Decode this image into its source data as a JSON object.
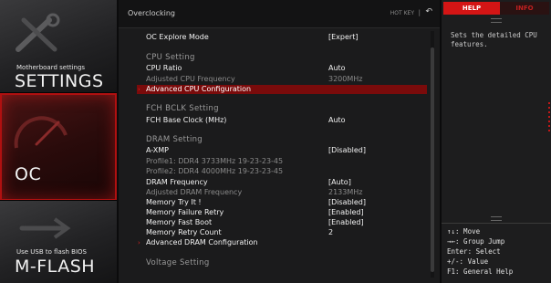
{
  "sidebar": {
    "settings": {
      "small": "Motherboard settings",
      "big": "SETTINGS"
    },
    "oc": {
      "big": "OC"
    },
    "mflash": {
      "small": "Use USB to flash BIOS",
      "big": "M-FLASH"
    }
  },
  "header": {
    "title": "Overclocking",
    "hotkey": "HOT KEY",
    "separator": "|",
    "back_icon": "back-arrow-icon"
  },
  "rows": [
    {
      "label": "OC Explore Mode",
      "value": "[Expert]",
      "style": "white"
    },
    {
      "label": "CPU  Setting",
      "value": "",
      "style": "header"
    },
    {
      "label": "CPU Ratio",
      "value": "Auto",
      "style": "white"
    },
    {
      "label": "Adjusted CPU Frequency",
      "value": "3200MHz",
      "style": "gray"
    },
    {
      "label": "Advanced CPU Configuration",
      "value": "",
      "style": "selected"
    },
    {
      "label": "FCH  BCLK  Setting",
      "value": "",
      "style": "header"
    },
    {
      "label": "FCH Base Clock (MHz)",
      "value": "Auto",
      "style": "white"
    },
    {
      "label": "DRAM  Setting",
      "value": "",
      "style": "header"
    },
    {
      "label": "A-XMP",
      "value": "[Disabled]",
      "style": "white"
    },
    {
      "label": "Profile1: DDR4 3733MHz 19-23-23-45",
      "value": "",
      "style": "gray"
    },
    {
      "label": "Profile2: DDR4 4000MHz 19-23-23-45",
      "value": "",
      "style": "gray"
    },
    {
      "label": "DRAM Frequency",
      "value": "[Auto]",
      "style": "white"
    },
    {
      "label": "Adjusted DRAM Frequency",
      "value": "2133MHz",
      "style": "gray"
    },
    {
      "label": "Memory Try It !",
      "value": "[Disabled]",
      "style": "white"
    },
    {
      "label": "Memory Failure Retry",
      "value": "[Enabled]",
      "style": "white"
    },
    {
      "label": "Memory Fast Boot",
      "value": "[Enabled]",
      "style": "white"
    },
    {
      "label": "Memory Retry Count",
      "value": "2",
      "style": "white"
    },
    {
      "label": "Advanced DRAM Configuration",
      "value": "",
      "style": "white"
    },
    {
      "label": "Voltage  Setting",
      "value": "",
      "style": "header"
    }
  ],
  "help": {
    "tab_help": "HELP",
    "tab_info": "INFO",
    "text": "Sets the detailed CPU features.",
    "keys": [
      "↑↓: Move",
      "→←: Group Jump",
      "Enter: Select",
      "+/-: Value",
      "F1: General Help"
    ]
  },
  "colors": {
    "accent": "#d41515",
    "selected_row": "#7a0b0b",
    "background": "#1b1b1c"
  }
}
